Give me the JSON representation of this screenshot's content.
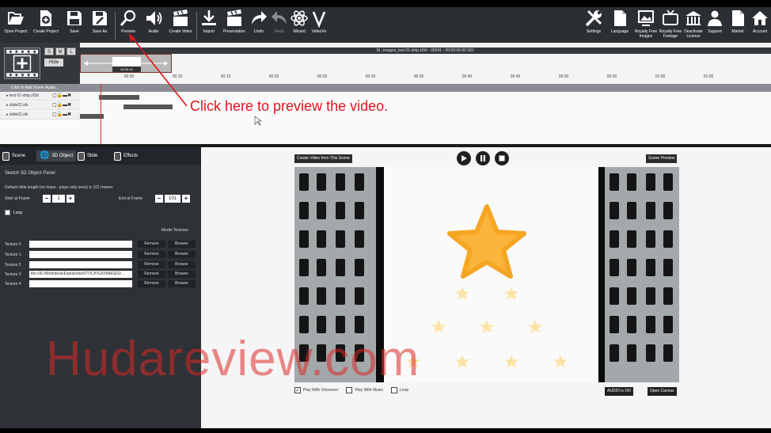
{
  "toolbar": {
    "items": [
      {
        "label": "Open Project",
        "icon": "open-project-icon"
      },
      {
        "label": "Create Project",
        "icon": "create-project-icon"
      },
      {
        "label": "Save",
        "icon": "save-icon"
      },
      {
        "label": "Save As",
        "icon": "save-as-icon"
      },
      {
        "label": "Preview",
        "icon": "magnifier-icon"
      },
      {
        "label": "Audio",
        "icon": "speaker-icon"
      },
      {
        "label": "Create Video",
        "icon": "clapper-icon"
      },
      {
        "label": "Import",
        "icon": "download-icon"
      },
      {
        "label": "Presentation",
        "icon": "presentation-icon"
      },
      {
        "label": "Undo",
        "icon": "undo-icon"
      },
      {
        "label": "Redo",
        "icon": "redo-icon"
      },
      {
        "label": "Wizard",
        "icon": "atom-icon"
      },
      {
        "label": "VideoVo",
        "icon": "v-icon"
      }
    ],
    "right_items": [
      {
        "label": "Settings",
        "icon": "tools-icon"
      },
      {
        "label": "Language",
        "icon": "document-icon"
      },
      {
        "label": "Royalty Free Images",
        "icon": "images-icon"
      },
      {
        "label": "Royalty Free Footage",
        "icon": "tv-icon"
      },
      {
        "label": "Deactivate License",
        "icon": "building-icon"
      },
      {
        "label": "Support",
        "icon": "person-icon"
      },
      {
        "label": "Market",
        "icon": "market-icon"
      },
      {
        "label": "Account",
        "icon": "home-icon"
      }
    ]
  },
  "timeline": {
    "size_buttons": [
      "S",
      "M",
      "L"
    ],
    "hide_label": "Hide",
    "file_label": "M...images_test 01-ship.zf3d - 00041 - 00:00:06.60 S01",
    "current_time": "00:09.04",
    "ticks": [
      "00:05",
      "00:10",
      "00:15",
      "00:20",
      "00:25",
      "00:30",
      "00:35",
      "00:40",
      "00:45",
      "00:50",
      "00:55",
      "01:00",
      "01:05"
    ],
    "add_audio": "Click to Add Scene Audio...",
    "tracks": [
      {
        "name": "test 01-ship.zf3d"
      },
      {
        "name": "slide02.sfs"
      },
      {
        "name": "slide01.sfs"
      }
    ]
  },
  "annotation": {
    "text": "Click here to preview the video.",
    "color": "#e3141b"
  },
  "left_panel": {
    "tabs": [
      {
        "label": "Scene"
      },
      {
        "label": "3D Object"
      },
      {
        "label": "Slide"
      },
      {
        "label": "Effects"
      }
    ],
    "title": "Sketch 3D Object Panel",
    "description": "Default slide length (no loops - plays only once) is 101 frames",
    "start_label": "Start at Frame",
    "start_value": "1",
    "end_label": "End at Frame",
    "end_value": "101",
    "loop_label": "Loop",
    "model_textures_label": "Model Textures",
    "textures": [
      {
        "label": "Texture 0",
        "value": "",
        "remove": "Remove",
        "browse": "Browse"
      },
      {
        "label": "Texture 1",
        "value": "",
        "remove": "Remove",
        "browse": "Browse"
      },
      {
        "label": "Texture 2",
        "value": "",
        "remove": "Remove",
        "browse": "Browse"
      },
      {
        "label": "Texture 3",
        "value": "file:///E:/Workdesk/Explaindio/STOCK%20IMAGES/...",
        "remove": "Remove",
        "browse": "Browse"
      },
      {
        "label": "Texture 4",
        "value": "",
        "remove": "Remove",
        "browse": "Browse"
      }
    ]
  },
  "preview": {
    "create_video_label": "Create Video from This Scene",
    "scene_preview_label": "Scene Preview",
    "play_with_voiceover": "Play With Voiceover",
    "play_with_music": "Play With Music",
    "loop": "Loop",
    "audio_on": "AUDIO is ON",
    "open_canvas": "Open Canvas"
  },
  "watermark": "Hudareview.com",
  "colors": {
    "toolbar_bg": "#2b2f33",
    "star": "#fbb43c",
    "accent_red": "#e3141b"
  }
}
